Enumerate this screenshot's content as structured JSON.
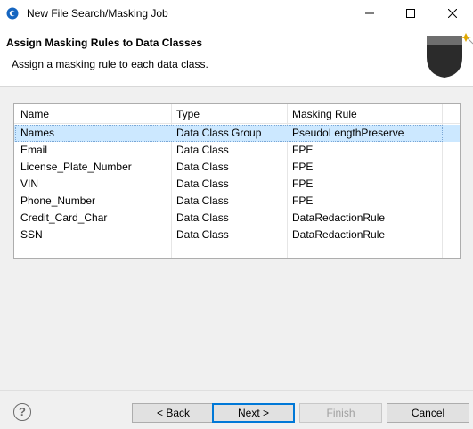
{
  "window": {
    "title": "New File Search/Masking Job"
  },
  "banner": {
    "title": "Assign Masking Rules to Data Classes",
    "description": "Assign a masking rule to each data class."
  },
  "table": {
    "columns": [
      "Name",
      "Type",
      "Masking Rule"
    ],
    "rows": [
      {
        "name": "Names",
        "type": "Data Class Group",
        "rule": "PseudoLengthPreserve",
        "selected": true
      },
      {
        "name": "Email",
        "type": "Data Class",
        "rule": "FPE"
      },
      {
        "name": "License_Plate_Number",
        "type": "Data Class",
        "rule": "FPE"
      },
      {
        "name": "VIN",
        "type": "Data Class",
        "rule": "FPE"
      },
      {
        "name": "Phone_Number",
        "type": "Data Class",
        "rule": "FPE"
      },
      {
        "name": "Credit_Card_Char",
        "type": "Data Class",
        "rule": "DataRedactionRule"
      },
      {
        "name": "SSN",
        "type": "Data Class",
        "rule": "DataRedactionRule"
      }
    ]
  },
  "buttons": {
    "back": "< Back",
    "next": "Next >",
    "finish": "Finish",
    "cancel": "Cancel",
    "help": "?"
  },
  "colors": {
    "selection": "#cce8ff",
    "primary_border": "#0078d7"
  }
}
